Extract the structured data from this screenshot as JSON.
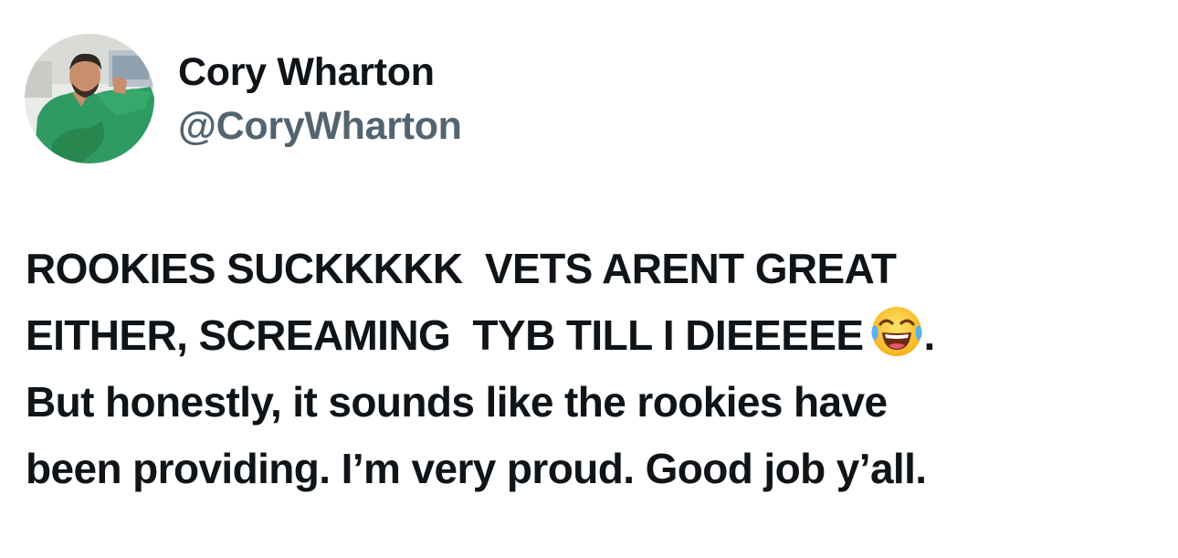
{
  "user": {
    "display_name": "Cory Wharton",
    "handle": "@CoryWharton",
    "avatar_icon": "profile-photo-green-shirt"
  },
  "tweet": {
    "line1": "ROOKIES SUCKKKKK  VETS ARENT GREAT",
    "line2_before_emoji": "EITHER, SCREAMING  TYB TILL I DIEEEEE",
    "emoji_icon": "face-with-tears-of-joy-icon",
    "line2_after_emoji": ".",
    "line3": "But honestly, it sounds like the rookies have",
    "line4": "been providing. I’m very proud. Good job y’all."
  },
  "colors": {
    "text_primary": "#0f1419",
    "text_secondary": "#536471",
    "background": "#ffffff"
  }
}
